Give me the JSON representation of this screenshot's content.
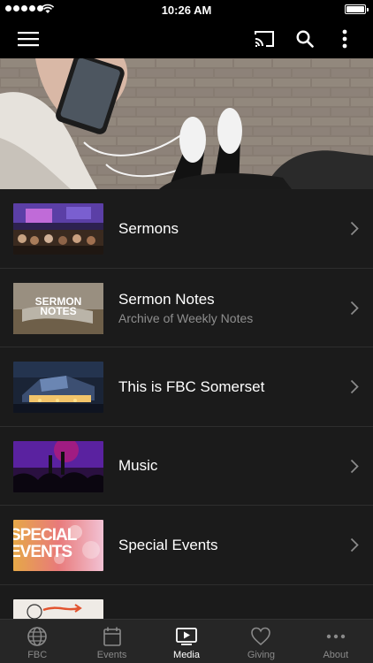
{
  "status_bar": {
    "time": "10:26 AM"
  },
  "nav": {
    "menu_icon": "hamburger-icon",
    "cast_icon": "cast-icon",
    "search_icon": "search-icon",
    "more_icon": "more-vertical-icon"
  },
  "media_list": [
    {
      "title": "Sermons",
      "subtitle": ""
    },
    {
      "title": "Sermon Notes",
      "subtitle": "Archive of Weekly Notes",
      "thumb_text": "SERMON NOTES"
    },
    {
      "title": "This is FBC Somerset",
      "subtitle": ""
    },
    {
      "title": "Music",
      "subtitle": ""
    },
    {
      "title": "Special Events",
      "subtitle": "",
      "thumb_text": "SPECIAL EVENTS"
    },
    {
      "title": "",
      "subtitle": ""
    }
  ],
  "tabs": [
    {
      "label": "FBC",
      "icon": "globe-icon",
      "active": false
    },
    {
      "label": "Events",
      "icon": "calendar-icon",
      "active": false
    },
    {
      "label": "Media",
      "icon": "play-icon",
      "active": true
    },
    {
      "label": "Giving",
      "icon": "heart-icon",
      "active": false
    },
    {
      "label": "About",
      "icon": "ellipsis-icon",
      "active": false
    }
  ],
  "colors": {
    "background": "#1b1b1b",
    "bar": "#000000",
    "tab_bar": "#262626",
    "inactive": "#8a8a8a",
    "active": "#ffffff"
  }
}
